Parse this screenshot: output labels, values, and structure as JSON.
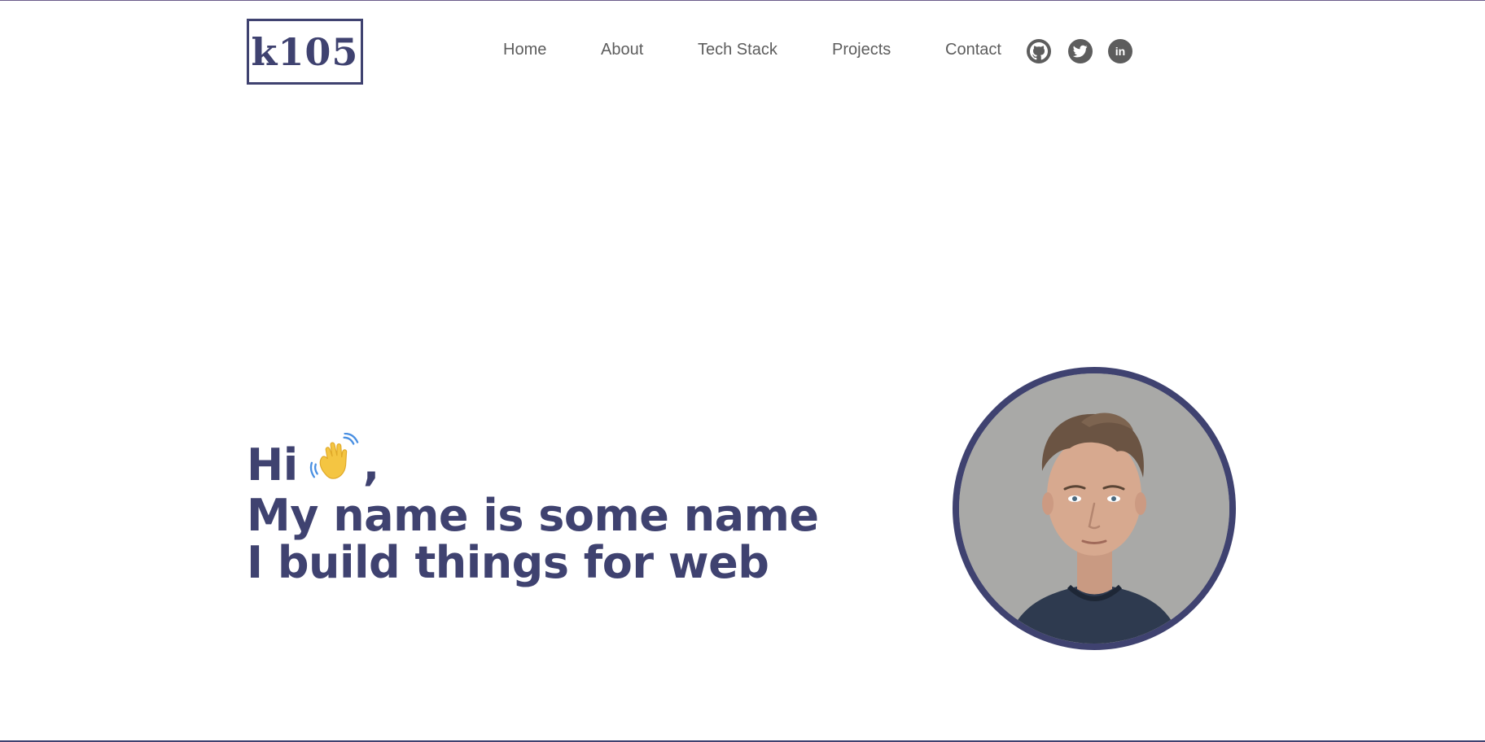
{
  "header": {
    "logo_text": "k105",
    "nav": [
      {
        "label": "Home"
      },
      {
        "label": "About"
      },
      {
        "label": "Tech Stack"
      },
      {
        "label": "Projects"
      },
      {
        "label": "Contact"
      }
    ],
    "social": [
      {
        "icon": "github-icon"
      },
      {
        "icon": "twitter-icon"
      },
      {
        "icon": "linkedin-icon",
        "text": "in"
      }
    ]
  },
  "hero": {
    "greeting": "Hi",
    "greeting_emoji": "waving-hand-icon",
    "greeting_suffix": ",",
    "line2": "My name is some name",
    "line3": "I build things for web"
  },
  "colors": {
    "accent": "#3f4270",
    "nav_text": "#5d5d5d",
    "background": "#ffffff",
    "emoji": "#f4c542"
  }
}
